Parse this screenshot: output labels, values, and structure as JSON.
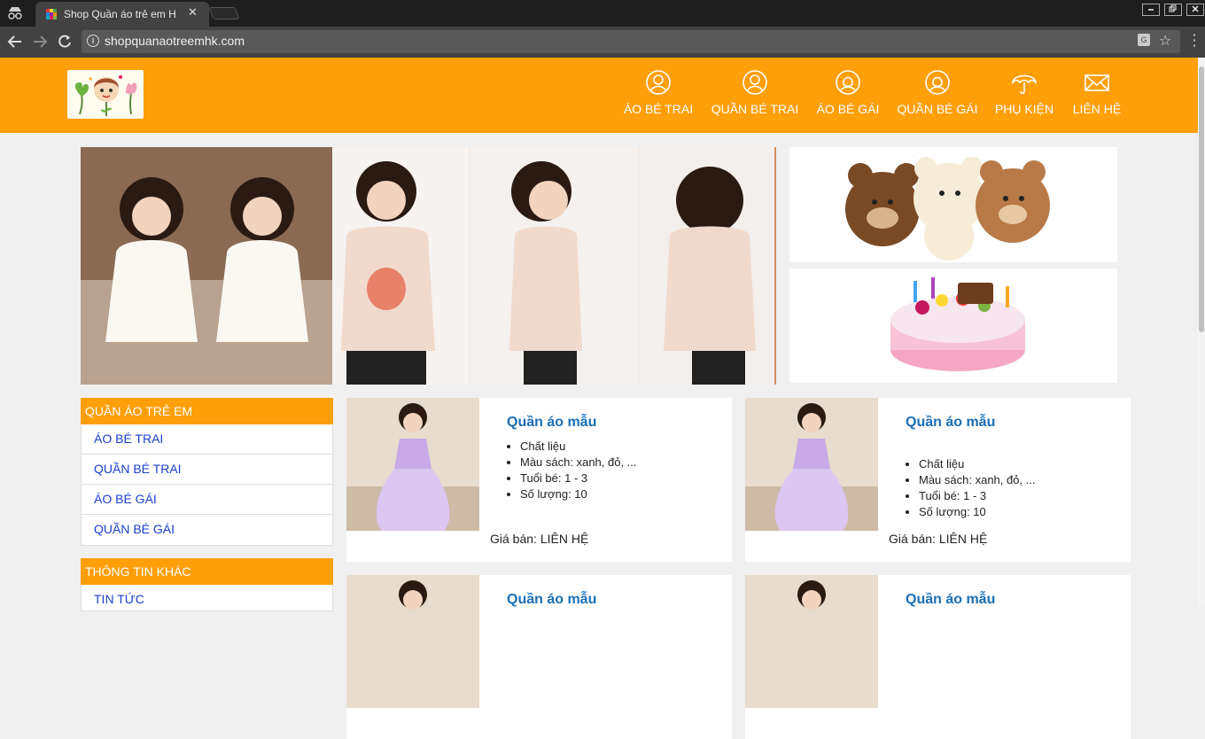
{
  "browser": {
    "tab_title": "Shop Quần áo trẻ em H",
    "url": "shopquanaotreemhk.com",
    "tab_close": "✕"
  },
  "nav": {
    "items": [
      {
        "label": "ÁO BÉ TRAI",
        "icon": "user-circle-icon"
      },
      {
        "label": "QUẦN BÉ TRAI",
        "icon": "user-circle-icon"
      },
      {
        "label": "ÁO BÉ GÁI",
        "icon": "girl-circle-icon"
      },
      {
        "label": "QUẦN BÉ GÁI",
        "icon": "girl-circle-icon"
      },
      {
        "label": "PHỤ KIỆN",
        "icon": "umbrella-icon"
      },
      {
        "label": "LIÊN HỆ",
        "icon": "envelope-icon"
      }
    ]
  },
  "sidebar": {
    "categories_title": "QUẦN ÁO TRẺ EM",
    "categories": [
      "ÁO BÉ TRAI",
      "QUẦN BÉ TRAI",
      "ÁO BÉ GÁI",
      "QUẦN BÉ GÁI"
    ],
    "other_title": "THÔNG TIN KHÁC",
    "other": [
      "TIN TỨC"
    ]
  },
  "products": [
    {
      "name": "Quần áo mẫu",
      "specs": [
        "Chất liệu",
        "Màu sách: xanh, đỏ, ...",
        "Tuổi bé: 1 - 3",
        "Số lượng: 10"
      ],
      "price": "Giá bán: LIÊN HỆ"
    },
    {
      "name": "Quần áo mẫu",
      "specs": [
        "Chất liệu",
        "Màu sách: xanh, đỏ, ...",
        "Tuổi bé: 1 - 3",
        "Số lượng: 10"
      ],
      "price": "Giá bán: LIÊN HỆ"
    },
    {
      "name": "Quần áo mẫu"
    },
    {
      "name": "Quần áo mẫu"
    }
  ],
  "colors": {
    "brand_orange": "#ff9f0a",
    "link_blue": "#1a3fcf",
    "product_title_blue": "#1a6fb5"
  }
}
